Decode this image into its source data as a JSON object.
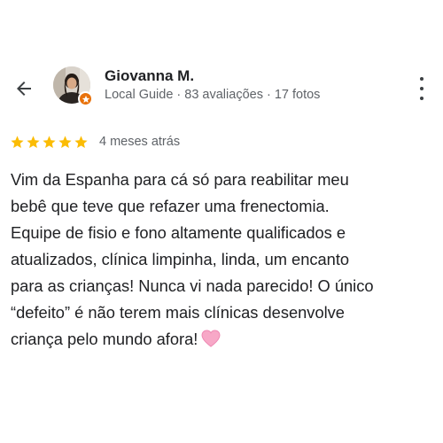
{
  "reviewer": {
    "name": "Giovanna M.",
    "meta": "Local Guide · 83 avaliações · 17 fotos",
    "avatar_icon": "profile-photo",
    "badge_icon": "local-guide-star-icon",
    "badge_color": "#e8710a"
  },
  "review": {
    "rating": 5,
    "rating_max": 5,
    "star_color": "#fbbc04",
    "time": "4 meses atrás",
    "text": "Vim da Espanha para cá só para reabilitar meu\nbebê que teve que refazer uma frenectomia.\nEquipe de fisio e fono altamente qualificados e\natualizados, clínica limpinha, linda, um encanto\npara as crianças! Nunca vi nada parecido! O único\n“defeito” é não terem mais clínicas desenvolve\ncriança pelo mundo afora!",
    "emoji": "pink-heart-icon",
    "emoji_color": "#f7a8c7"
  },
  "toolbar": {
    "back_icon": "arrow-back-icon",
    "more_icon": "more-vert-icon"
  }
}
